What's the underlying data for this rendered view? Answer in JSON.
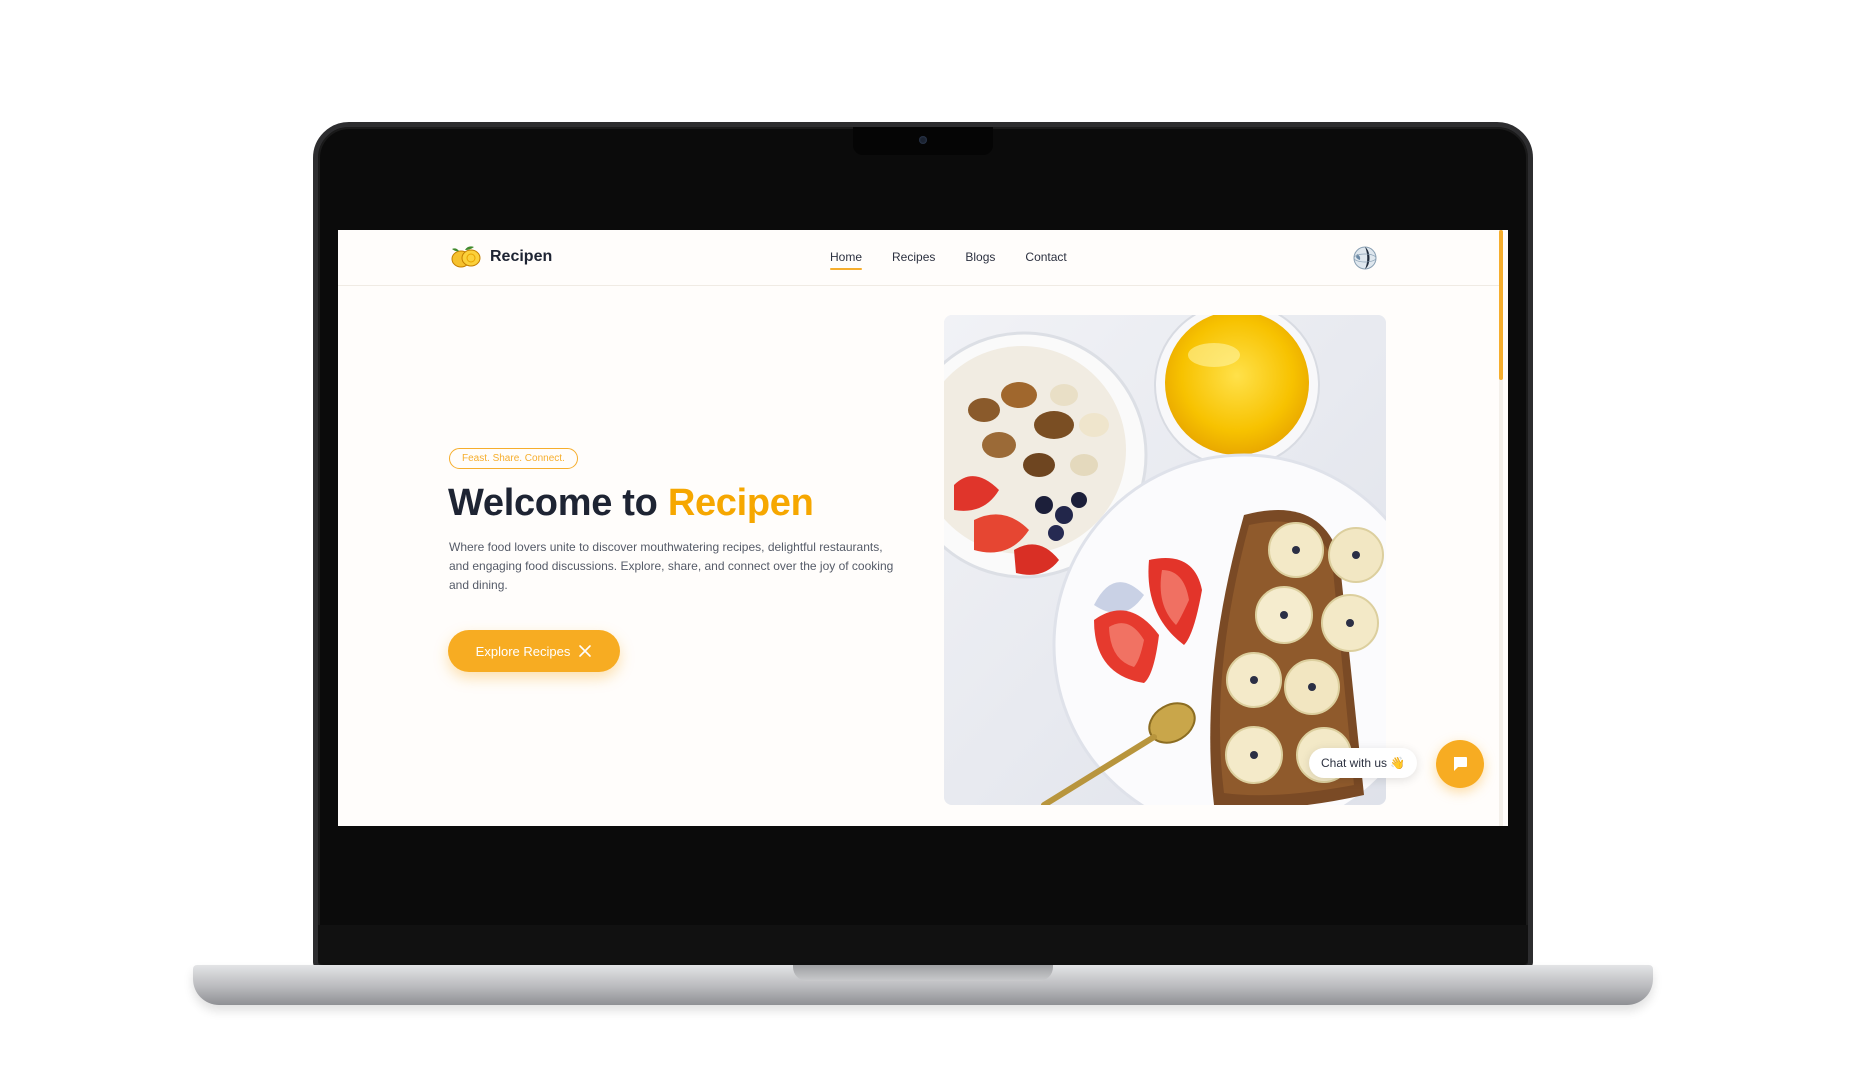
{
  "brand": {
    "name": "Recipen"
  },
  "nav": {
    "items": [
      {
        "label": "Home",
        "active": true
      },
      {
        "label": "Recipes",
        "active": false
      },
      {
        "label": "Blogs",
        "active": false
      },
      {
        "label": "Contact",
        "active": false
      }
    ]
  },
  "hero": {
    "tagline": "Feast. Share. Connect.",
    "title_prefix": "Welcome to ",
    "title_accent": "Recipen",
    "description": "Where food lovers unite to discover mouthwatering recipes, delightful restaurants, and engaging food discussions. Explore, share, and connect over the joy of cooking and dining.",
    "cta_label": "Explore Recipes"
  },
  "chat": {
    "label": "Chat with us 👋"
  },
  "icons": [
    "lemon-logo-icon",
    "globe-icon",
    "close-x-icon",
    "chat-bubble-icon"
  ],
  "colors": {
    "accent": "#f6ae2d",
    "text_dark": "#1e2433",
    "background": "#fffdfb"
  }
}
